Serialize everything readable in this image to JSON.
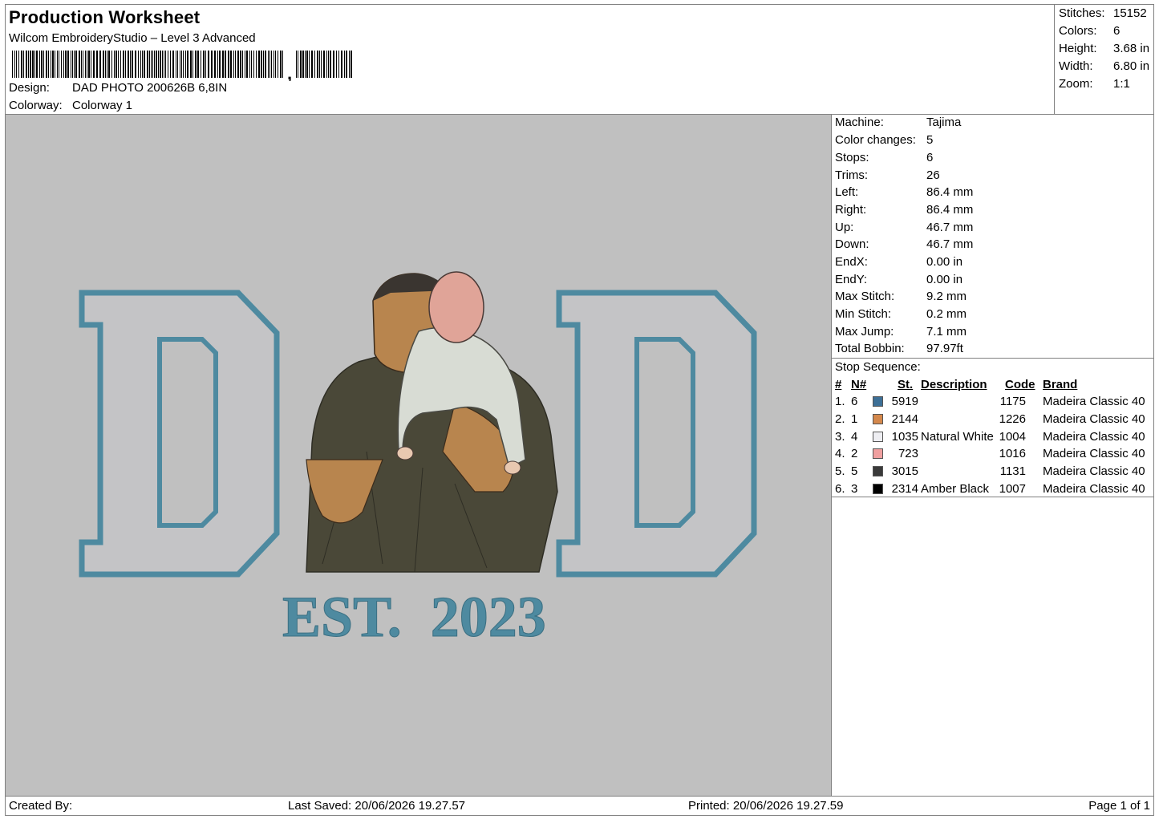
{
  "header": {
    "title": "Production Worksheet",
    "subtitle": "Wilcom EmbroideryStudio – Level 3 Advanced",
    "design_label": "Design:",
    "design_value": "DAD PHOTO 200626B 6,8IN",
    "colorway_label": "Colorway:",
    "colorway_value": "Colorway 1"
  },
  "stats": [
    {
      "label": "Stitches:",
      "value": "15152"
    },
    {
      "label": "Colors:",
      "value": "6"
    },
    {
      "label": "Height:",
      "value": "3.68 in"
    },
    {
      "label": "Width:",
      "value": "6.80 in"
    },
    {
      "label": "Zoom:",
      "value": "1:1"
    }
  ],
  "machine": [
    {
      "label": "Machine:",
      "value": "Tajima"
    },
    {
      "label": "Color changes:",
      "value": "5"
    },
    {
      "label": "Stops:",
      "value": "6"
    },
    {
      "label": "Trims:",
      "value": "26"
    },
    {
      "label": "Left:",
      "value": "86.4 mm"
    },
    {
      "label": "Right:",
      "value": "86.4 mm"
    },
    {
      "label": "Up:",
      "value": "46.7 mm"
    },
    {
      "label": "Down:",
      "value": "46.7 mm"
    },
    {
      "label": "EndX:",
      "value": "0.00 in"
    },
    {
      "label": "EndY:",
      "value": "0.00 in"
    },
    {
      "label": "Max Stitch:",
      "value": "9.2 mm"
    },
    {
      "label": "Min Stitch:",
      "value": "0.2 mm"
    },
    {
      "label": "Max Jump:",
      "value": "7.1 mm"
    },
    {
      "label": "Total Bobbin:",
      "value": "97.97ft"
    }
  ],
  "stop_sequence": {
    "title": "Stop Sequence:",
    "headers": {
      "num": "#",
      "n": "N#",
      "st": "St.",
      "description": "Description",
      "code": "Code",
      "brand": "Brand"
    },
    "rows": [
      {
        "num": "1.",
        "n": "6",
        "color": "#3d6f96",
        "st": "5919",
        "description": "",
        "code": "1175",
        "brand": "Madeira Classic 40"
      },
      {
        "num": "2.",
        "n": "1",
        "color": "#d4884c",
        "st": "2144",
        "description": "",
        "code": "1226",
        "brand": "Madeira Classic 40"
      },
      {
        "num": "3.",
        "n": "4",
        "color": "#eeeef2",
        "st": "1035",
        "description": "Natural White",
        "code": "1004",
        "brand": "Madeira Classic 40"
      },
      {
        "num": "4.",
        "n": "2",
        "color": "#f0a0a0",
        "st": "723",
        "description": "",
        "code": "1016",
        "brand": "Madeira Classic 40"
      },
      {
        "num": "5.",
        "n": "5",
        "color": "#3a3a3a",
        "st": "3015",
        "description": "",
        "code": "1131",
        "brand": "Madeira Classic 40"
      },
      {
        "num": "6.",
        "n": "3",
        "color": "#000000",
        "st": "2314",
        "description": "Amber Black",
        "code": "1007",
        "brand": "Madeira Classic 40"
      }
    ]
  },
  "design_preview": {
    "letters": [
      "D",
      "D"
    ],
    "text": "EST.  2023",
    "background_color": "#c0c0c0",
    "thread_blue": "#4e8aa0"
  },
  "footer": {
    "created_by": "Created By:",
    "last_saved": "Last Saved: 20/06/2026 19.27.57",
    "printed": "Printed: 20/06/2026 19.27.59",
    "page": "Page 1 of 1"
  }
}
